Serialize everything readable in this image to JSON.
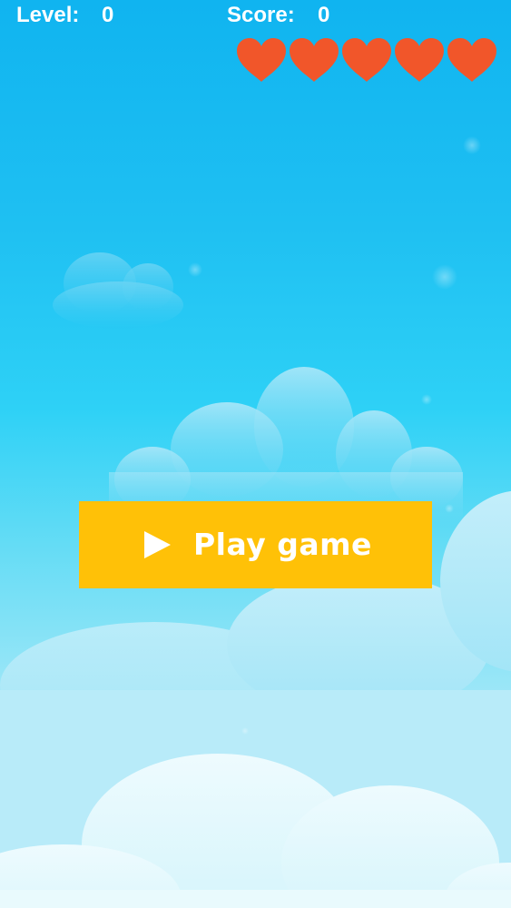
{
  "hud": {
    "level_label": "Level:",
    "level_value": "0",
    "score_label": "Score:",
    "score_value": "0",
    "lives": 5,
    "lives_max": 5,
    "heart_icon": "heart-icon",
    "heart_color": "#f1562a"
  },
  "menu": {
    "play_label": "Play game",
    "play_icon": "play-icon",
    "button_color": "#ffc107"
  },
  "colors": {
    "sky_top": "#10b4f0",
    "sky_bottom": "#d6f5fb",
    "text": "#ffffff"
  }
}
